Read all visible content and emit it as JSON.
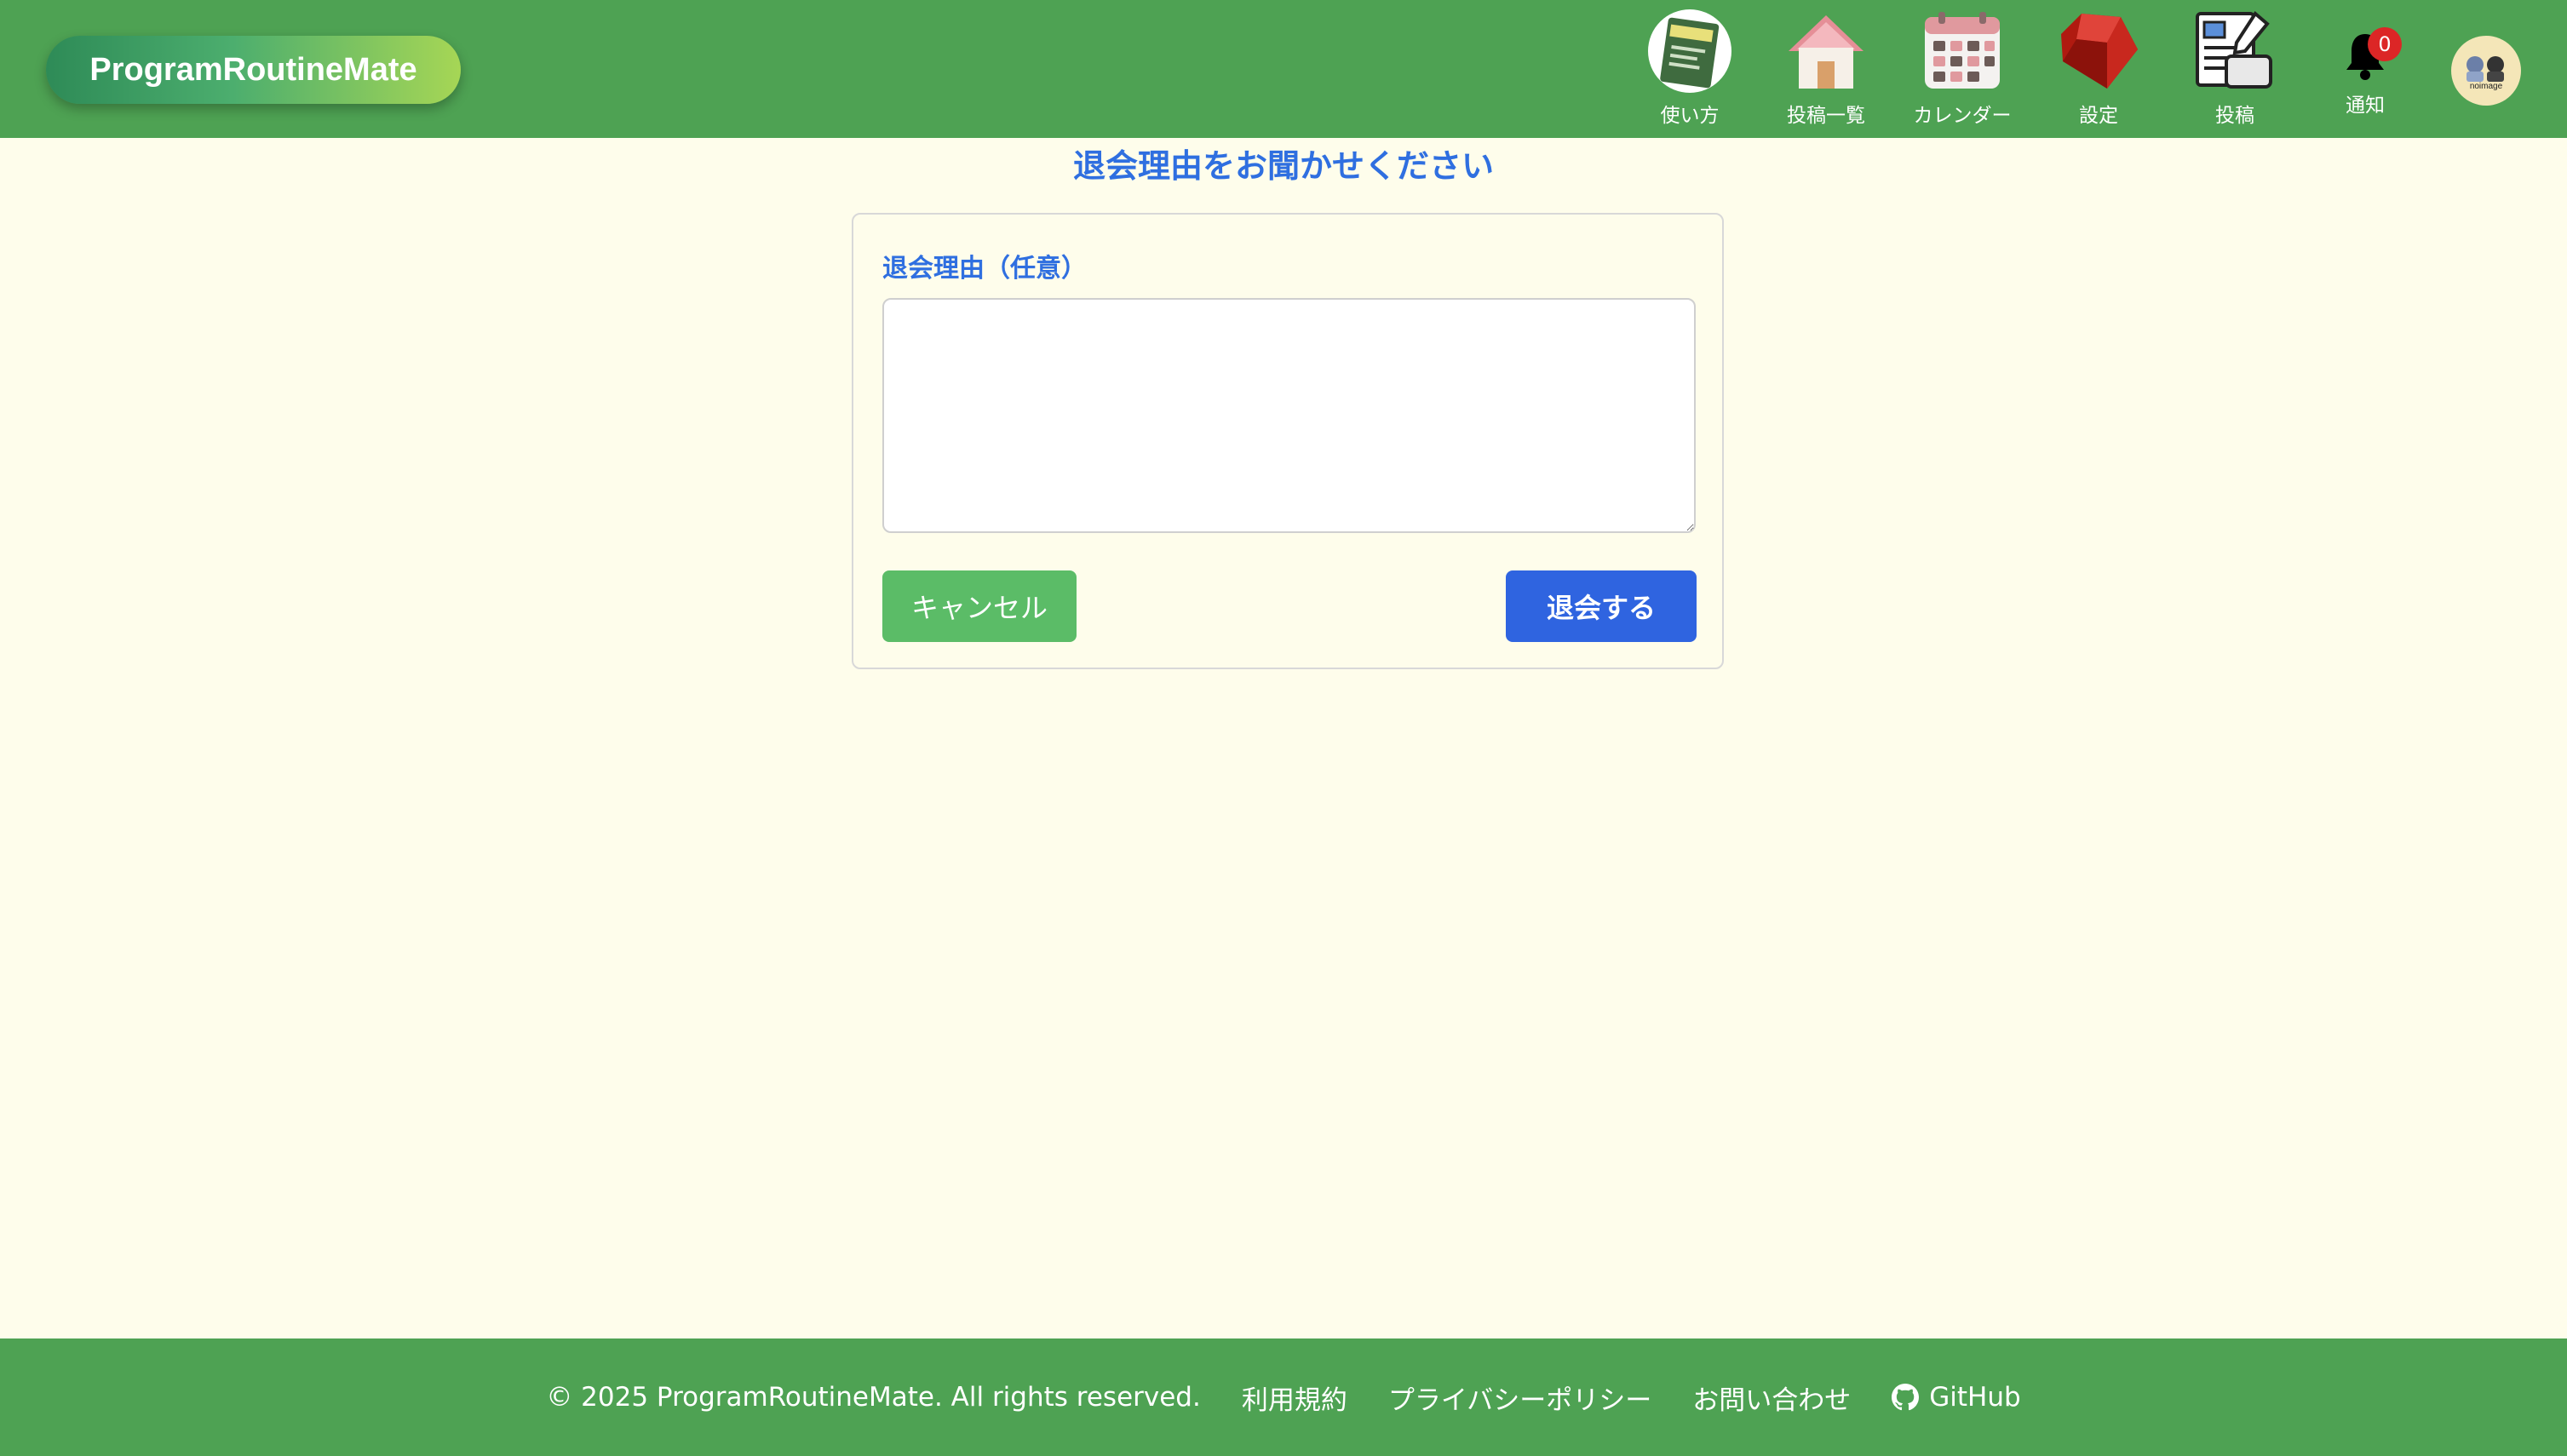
{
  "header": {
    "logo": "ProgramRoutineMate",
    "nav": [
      {
        "label": "使い方",
        "icon": "manual-book-icon"
      },
      {
        "label": "投稿一覧",
        "icon": "house-icon"
      },
      {
        "label": "カレンダー",
        "icon": "calendar-icon"
      },
      {
        "label": "設定",
        "icon": "ruby-gem-icon"
      },
      {
        "label": "投稿",
        "icon": "post-document-icon"
      }
    ],
    "notifications": {
      "label": "通知",
      "count": "0"
    },
    "avatar_text": "noimage"
  },
  "main": {
    "title": "退会理由をお聞かせください",
    "field_label": "退会理由（任意）",
    "textarea_value": "",
    "cancel_label": "キャンセル",
    "submit_label": "退会する"
  },
  "footer": {
    "copyright": "© 2025 ProgramRoutineMate. All rights reserved.",
    "links": [
      "利用規約",
      "プライバシーポリシー",
      "お問い合わせ",
      "GitHub"
    ]
  },
  "colors": {
    "header_bg": "#4ea253",
    "page_bg": "#fefdeb",
    "accent_blue": "#2f64e0",
    "cancel_green": "#5bbc67",
    "badge_red": "#dc2626"
  }
}
